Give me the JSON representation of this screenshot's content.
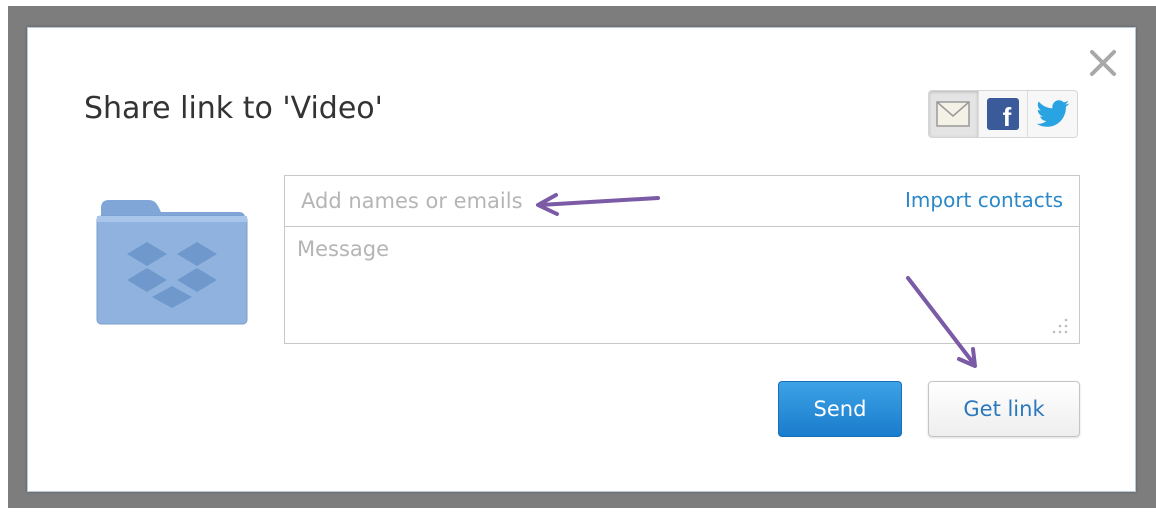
{
  "dialog": {
    "title": "Share link to 'Video'",
    "close_icon": "close-icon",
    "share_icons": [
      "email-icon",
      "facebook-icon",
      "twitter-icon"
    ]
  },
  "form": {
    "recipients_placeholder": "Add names or emails",
    "import_contacts_label": "Import contacts",
    "message_placeholder": "Message"
  },
  "buttons": {
    "send_label": "Send",
    "get_link_label": "Get link"
  },
  "colors": {
    "accent_blue": "#2b88c8",
    "send_button": "#1a7ccc",
    "annotation_arrow": "#7b5aa6",
    "folder": "#8fb3de"
  },
  "annotations": {
    "arrows": [
      "arrow-to-recipients-field",
      "arrow-to-get-link-button"
    ]
  }
}
